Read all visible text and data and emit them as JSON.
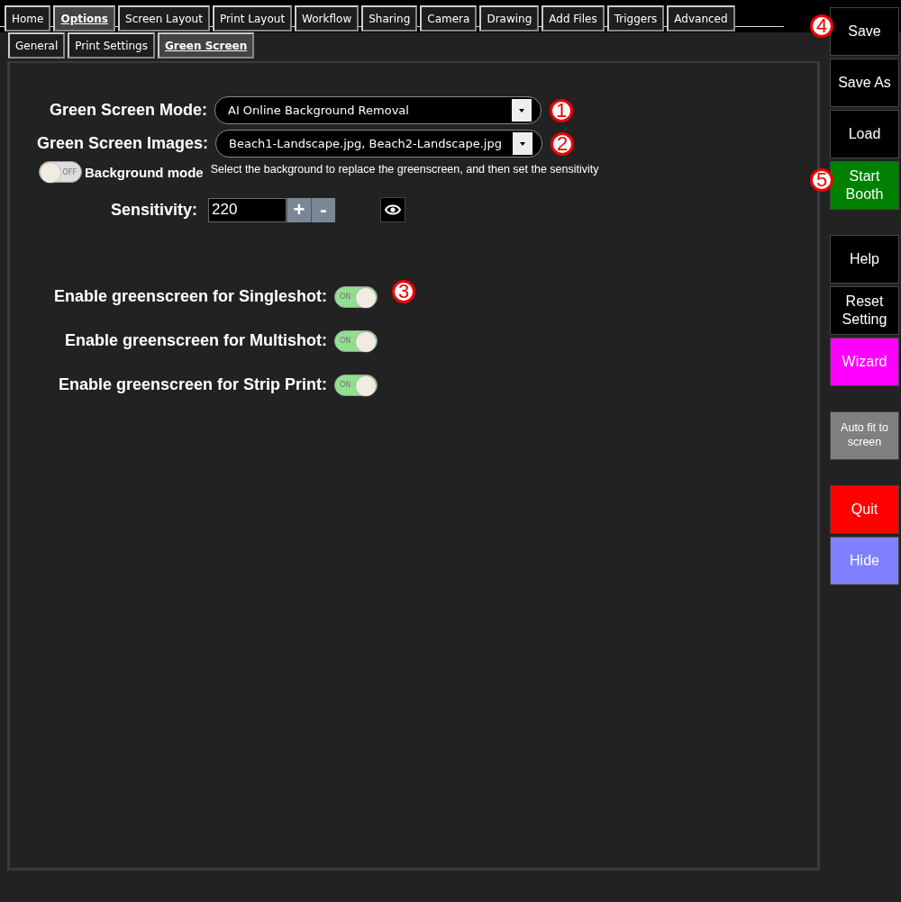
{
  "tabs": [
    {
      "label": "Home",
      "selected": false
    },
    {
      "label": "Options",
      "selected": true
    },
    {
      "label": "Screen Layout",
      "selected": false
    },
    {
      "label": "Print Layout",
      "selected": false
    },
    {
      "label": "Workflow",
      "selected": false
    },
    {
      "label": "Sharing",
      "selected": false
    },
    {
      "label": "Camera",
      "selected": false
    },
    {
      "label": "Drawing",
      "selected": false
    },
    {
      "label": "Add Files",
      "selected": false
    },
    {
      "label": "Triggers",
      "selected": false
    },
    {
      "label": "Advanced",
      "selected": false
    }
  ],
  "subtabs": [
    {
      "label": "General",
      "selected": false
    },
    {
      "label": "Print Settings",
      "selected": false
    },
    {
      "label": "Green Screen",
      "selected": true
    }
  ],
  "dropdowns": [
    {
      "label": "Green Screen Mode:",
      "value": "AI Online Background Removal",
      "badge": "1"
    },
    {
      "label": "Green Screen Images:",
      "value": "Beach1-Landscape.jpg, Beach2-Landscape.jpg",
      "badge": "2"
    }
  ],
  "background_mode": {
    "label": "Background mode",
    "on": false,
    "switch_text": "OFF"
  },
  "hint": "Select the background to replace the greenscreen, and then set the sensitivity",
  "sensitivity": {
    "label": "Sensitivity:",
    "value": "220",
    "plus": "+",
    "minus": "-"
  },
  "toggles": [
    {
      "label": "Enable greenscreen for Singleshot:",
      "on": true,
      "switch_text": "ON",
      "badge": "3"
    },
    {
      "label": "Enable greenscreen for Multishot:",
      "on": true,
      "switch_text": "ON"
    },
    {
      "label": "Enable greenscreen for Strip Print:",
      "on": true,
      "switch_text": "ON"
    }
  ],
  "sidebar": [
    {
      "label": "Save",
      "color": "#000000",
      "badge": "4"
    },
    {
      "label": "Save As",
      "color": "#000000"
    },
    {
      "label": "Load",
      "color": "#000000"
    },
    {
      "label": "Start Booth",
      "color": "#008000",
      "badge": "5"
    },
    {
      "kind": "spacer"
    },
    {
      "label": "Help",
      "color": "#000000"
    },
    {
      "label": "Reset Setting",
      "color": "#000000"
    },
    {
      "label": "Wizard",
      "color": "#ff00ff"
    },
    {
      "kind": "spacer"
    },
    {
      "label": "Auto fit to screen",
      "color": "#808080",
      "small": true
    },
    {
      "kind": "spacer"
    },
    {
      "label": "Quit",
      "color": "#ff0000"
    },
    {
      "label": "Hide",
      "color": "#8080ff"
    }
  ]
}
